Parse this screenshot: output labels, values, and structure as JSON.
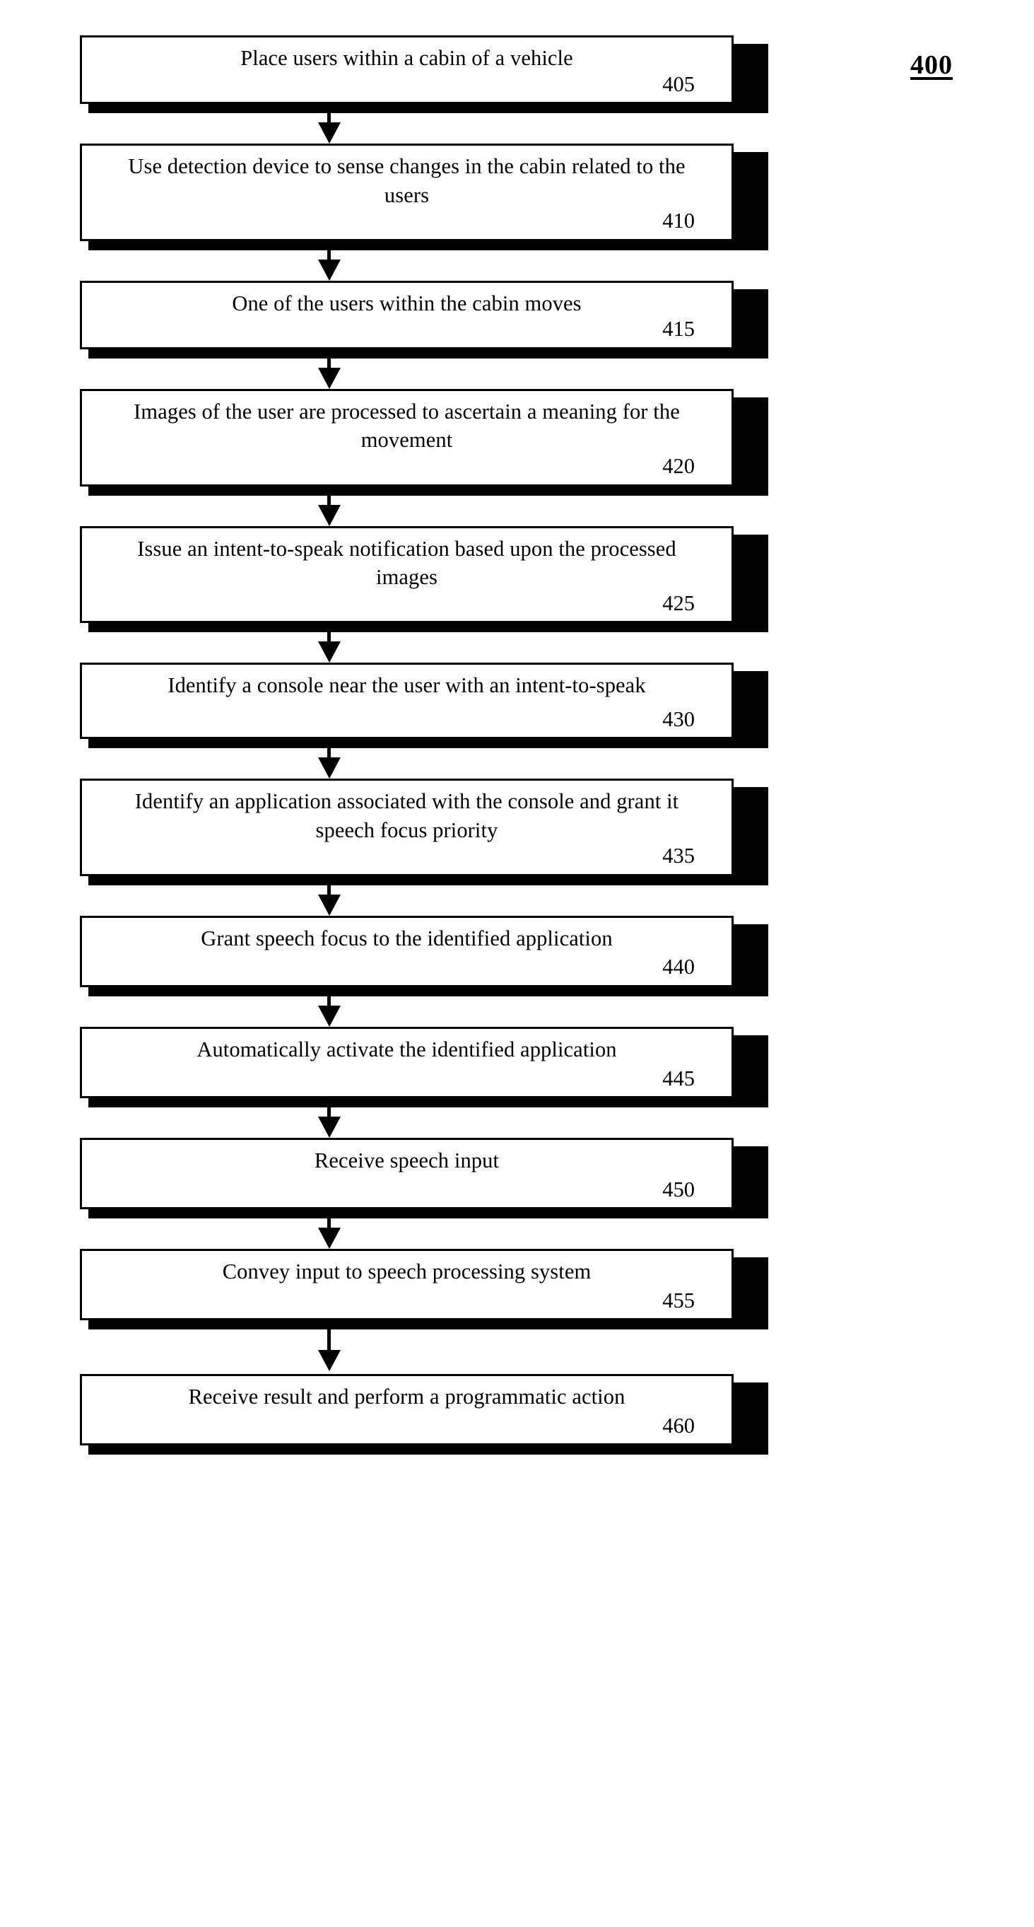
{
  "figure": {
    "number": "400"
  },
  "flowchart": {
    "type": "process-flow",
    "orientation": "vertical",
    "connector": "downward-arrow",
    "steps": [
      {
        "text": "Place users within a cabin of a vehicle",
        "number": "405",
        "lines": 1
      },
      {
        "text": "Use detection device to sense changes in the cabin related to the users",
        "number": "410",
        "lines": 2
      },
      {
        "text": "One of the users within the cabin moves",
        "number": "415",
        "lines": 1
      },
      {
        "text": "Images of the user are processed to ascertain a meaning for the movement",
        "number": "420",
        "lines": 2
      },
      {
        "text": "Issue an intent-to-speak notification based upon the processed images",
        "number": "425",
        "lines": 2
      },
      {
        "text": "Identify a console near the user with an intent-to-speak",
        "number": "430",
        "lines": 2
      },
      {
        "text": "Identify an application associated with the console and grant it speech focus priority",
        "number": "435",
        "lines": 2
      },
      {
        "text": "Grant speech focus to the identified application",
        "number": "440",
        "lines": 1
      },
      {
        "text": "Automatically activate the identified application",
        "number": "445",
        "lines": 1
      },
      {
        "text": "Receive speech input",
        "number": "450",
        "lines": 1
      },
      {
        "text": "Convey input to speech processing system",
        "number": "455",
        "lines": 1
      },
      {
        "text": "Receive result and perform a programmatic action",
        "number": "460",
        "lines": 1
      }
    ]
  }
}
